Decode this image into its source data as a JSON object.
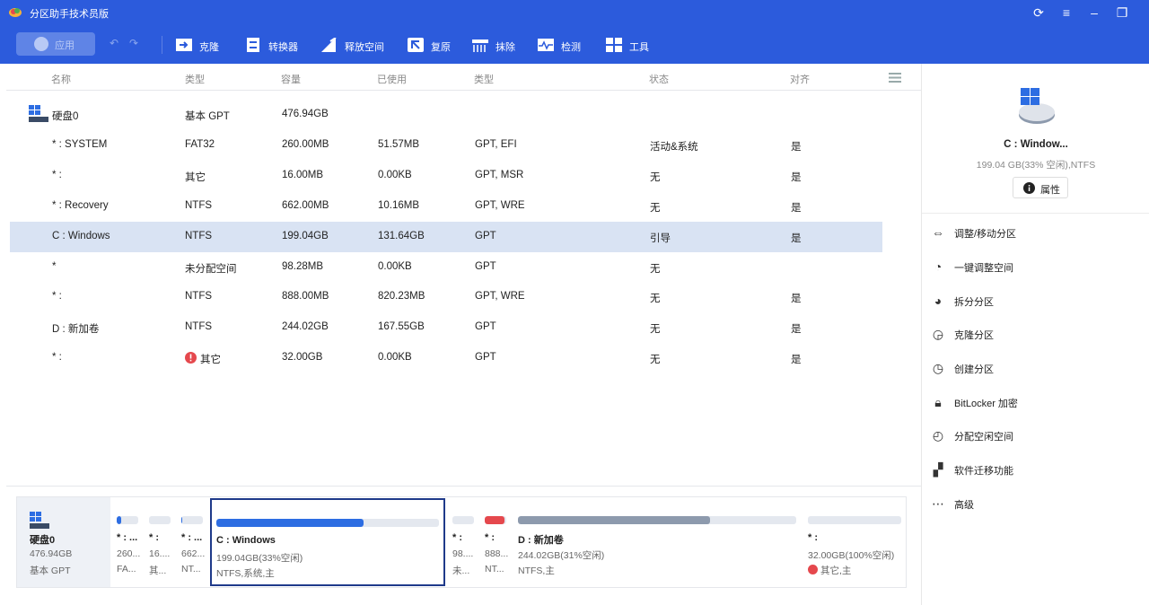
{
  "window": {
    "title": "分区助手技术员版"
  },
  "toolbar": {
    "apply": "应用",
    "items": [
      "克隆",
      "转换器",
      "释放空间",
      "复原",
      "抹除",
      "检测",
      "工具"
    ]
  },
  "table": {
    "headers": [
      "名称",
      "类型",
      "容量",
      "已使用",
      "类型",
      "状态",
      "对齐"
    ],
    "disk": {
      "name": "硬盘0",
      "type": "基本 GPT",
      "capacity": "476.94GB"
    },
    "rows": [
      {
        "name": "* : SYSTEM",
        "fs": "FAT32",
        "cap": "260.00MB",
        "used": "51.57MB",
        "type": "GPT, EFI",
        "status": "活动&系统",
        "align": "是"
      },
      {
        "name": "* :",
        "fs": "其它",
        "cap": "16.00MB",
        "used": "0.00KB",
        "type": "GPT, MSR",
        "status": "无",
        "align": "是"
      },
      {
        "name": "* : Recovery",
        "fs": "NTFS",
        "cap": "662.00MB",
        "used": "10.16MB",
        "type": "GPT, WRE",
        "status": "无",
        "align": "是"
      },
      {
        "name": "C : Windows",
        "fs": "NTFS",
        "cap": "199.04GB",
        "used": "131.64GB",
        "type": "GPT",
        "status": "引导",
        "align": "是"
      },
      {
        "name": "*",
        "fs": "未分配空间",
        "cap": "98.28MB",
        "used": "0.00KB",
        "type": "GPT",
        "status": "无",
        "align": ""
      },
      {
        "name": "* :",
        "fs": "NTFS",
        "cap": "888.00MB",
        "used": "820.23MB",
        "type": "GPT, WRE",
        "status": "无",
        "align": "是"
      },
      {
        "name": "D : 新加卷",
        "fs": "NTFS",
        "cap": "244.02GB",
        "used": "167.55GB",
        "type": "GPT",
        "status": "无",
        "align": "是"
      },
      {
        "name": "* :",
        "fs": "其它",
        "cap": "32.00GB",
        "used": "0.00KB",
        "type": "GPT",
        "status": "无",
        "align": "是"
      }
    ]
  },
  "diskmap": {
    "disk": {
      "name": "硬盘0",
      "size": "476.94GB",
      "type": "基本 GPT"
    },
    "segments": [
      {
        "name": "* : ...",
        "l2": "260...",
        "l3": "FA...",
        "fill": 0.2,
        "color": "#2d6de2"
      },
      {
        "name": "* :",
        "l2": "16....",
        "l3": "其...",
        "fill": 0,
        "color": "#2d6de2"
      },
      {
        "name": "* : ...",
        "l2": "662...",
        "l3": "NT...",
        "fill": 0.02,
        "color": "#2d6de2"
      },
      {
        "name": "C : Windows",
        "l2": "199.04GB(33%空闲)",
        "l3": "NTFS,系统,主",
        "fill": 0.66,
        "color": "#2d6de2"
      },
      {
        "name": "* :",
        "l2": "98....",
        "l3": "未...",
        "fill": 0,
        "color": "#2d6de2"
      },
      {
        "name": "* :",
        "l2": "888...",
        "l3": "NT...",
        "fill": 0.92,
        "color": "#e5484d"
      },
      {
        "name": "D : 新加卷",
        "l2": "244.02GB(31%空闲)",
        "l3": "NTFS,主",
        "fill": 0.69,
        "color": "#8d9aad"
      },
      {
        "name": "* :",
        "l2": "32.00GB(100%空闲)",
        "l3": "其它,主",
        "fill": 0,
        "color": "#2d6de2"
      }
    ]
  },
  "panel": {
    "name": "C : Window...",
    "info": "199.04 GB(33% 空闲),NTFS",
    "prop": "属性",
    "actions": [
      "调整/移动分区",
      "一键调整空间",
      "拆分分区",
      "克隆分区",
      "创建分区",
      "BitLocker 加密",
      "分配空闲空间",
      "软件迁移功能",
      "高级"
    ]
  },
  "colors": {
    "titlebar": "#2c5bdc",
    "selected_row": "#d9e3f3",
    "accent": "#2d6de2",
    "warn": "#e5484d"
  }
}
